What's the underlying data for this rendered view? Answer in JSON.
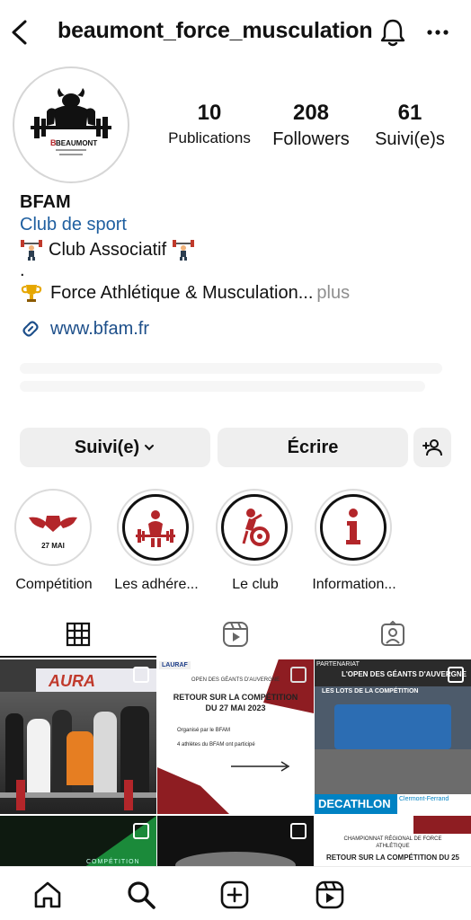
{
  "header": {
    "username": "beaumont_force_musculation"
  },
  "profile": {
    "avatar_text": "BEAUMONT",
    "stats": [
      {
        "num": "10",
        "label": "Publications"
      },
      {
        "num": "208",
        "label": "Followers"
      },
      {
        "num": "61",
        "label": "Suivi(e)s"
      }
    ],
    "name": "BFAM",
    "category": "Club de sport",
    "bio_line1": "Club Associatif",
    "bio_dot": ".",
    "bio_line2": "Force Athlétique & Musculation...",
    "bio_more": "plus",
    "website": "www.bfam.fr"
  },
  "actions": {
    "follow_label": "Suivi(e)",
    "write_label": "Écrire"
  },
  "highlights": [
    {
      "label": "Compétition",
      "badge": "27 MAI"
    },
    {
      "label": "Les adhére..."
    },
    {
      "label": "Le club"
    },
    {
      "label": "Information..."
    }
  ],
  "posts": {
    "post1_banner": "AURA",
    "post2_header": "OPEN DES GÉANTS D'AUVERGNE",
    "post2_title": "RETOUR SUR LA COMPÉTITION DU 27 MAI 2023",
    "post2_bullet1": "Organisé par le BFAM",
    "post2_bullet2": "4 athlètes du BFAM ont participé",
    "post2_tag": "LAURAF",
    "post3_top": "PARTENARIAT",
    "post3_title": "L'OPEN DES GÉANTS D'AUVERGNE",
    "post3_sub": "LES LOTS DE LA COMPÉTITION",
    "post3_brand": "DECATHLON",
    "post3_city": "Clermont-Ferrand",
    "post4_text": "COMPÉTITION",
    "post6_title": "CHAMPIONNAT RÉGIONAL DE FORCE ATHLÉTIQUE",
    "post6_sub": "RETOUR SUR LA COMPÉTITION DU 25"
  },
  "colors": {
    "accent_red": "#b3262a",
    "link_blue": "#1f5fa0",
    "button_bg": "#efefef"
  }
}
